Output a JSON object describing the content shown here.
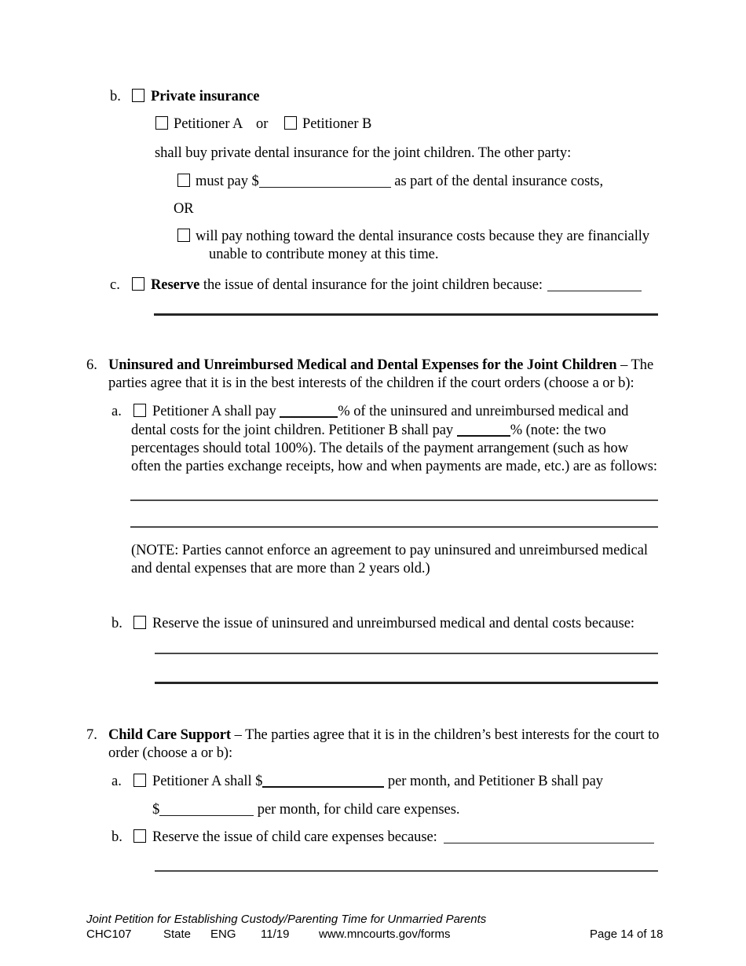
{
  "document": {
    "form_title": "Joint Petition for Establishing Custody/Parenting Time for Unmarried Parents",
    "form_number": "CHC107",
    "jurisdiction": "State",
    "language": "ENG",
    "revision_date": "11/19",
    "website": "www.mncourts.gov/forms",
    "page_label": "Page 14 of 18"
  },
  "dental_insurance": {
    "item_b_marker": "b.",
    "item_b_heading": "Private insurance",
    "petitioner_a_label": "Petitioner A",
    "or_between_petitioners": "or",
    "petitioner_b_label": "Petitioner B",
    "buy_line": "shall buy private dental insurance for the joint children.  The other party:",
    "must_pay_prefix": "must pay $",
    "must_pay_suffix": "as part of the dental insurance costs,",
    "or_label": "OR",
    "pay_nothing_line1": "will pay nothing toward the dental insurance costs because they are financially",
    "pay_nothing_line2": "unable to contribute money at this time.",
    "item_c_marker": "c.",
    "item_c_bold": "Reserve",
    "item_c_text": " the issue of dental insurance for the joint children because:"
  },
  "section6": {
    "number": "6.",
    "heading": "Uninsured and Unreimbursed Medical and Dental Expenses for the Joint Children",
    "heading_rest": " – The",
    "intro_line2": "parties agree that it is in the best interests of the children if the court orders (choose a or b):",
    "item_a_marker": "a.",
    "a_line1_pre": "Petitioner A shall pay ",
    "a_line1_post": "% of the uninsured and unreimbursed medical and",
    "a_line2_pre": "dental costs for the joint children.  Petitioner B shall pay ",
    "a_line2_post": "% (note: the two",
    "a_line3": "percentages should total 100%).  The details of the payment arrangement (such as how",
    "a_line4": "often the parties exchange receipts, how and when payments are made, etc.) are as follows:",
    "note_line1": " (NOTE: Parties cannot enforce an agreement to pay uninsured and unreimbursed medical",
    "note_line2": "and dental expenses that are more than 2 years old.)",
    "item_b_marker": "b.",
    "item_b_text": "Reserve the issue of uninsured and unreimbursed medical and dental costs because:"
  },
  "section7": {
    "number": "7.",
    "heading": "Child Care Support",
    "heading_rest": " – The parties agree that it is in the children’s best interests for the court to",
    "intro_line2": "order (choose a or b):",
    "item_a_marker": "a.",
    "a_line1_pre": "Petitioner A shall $",
    "a_line1_post": "per month, and Petitioner B shall pay",
    "a_line2_pre": "$",
    "a_line2_post": "per month, for child care expenses.",
    "item_b_marker": "b.",
    "item_b_text": "Reserve the issue of child care expenses because:"
  }
}
